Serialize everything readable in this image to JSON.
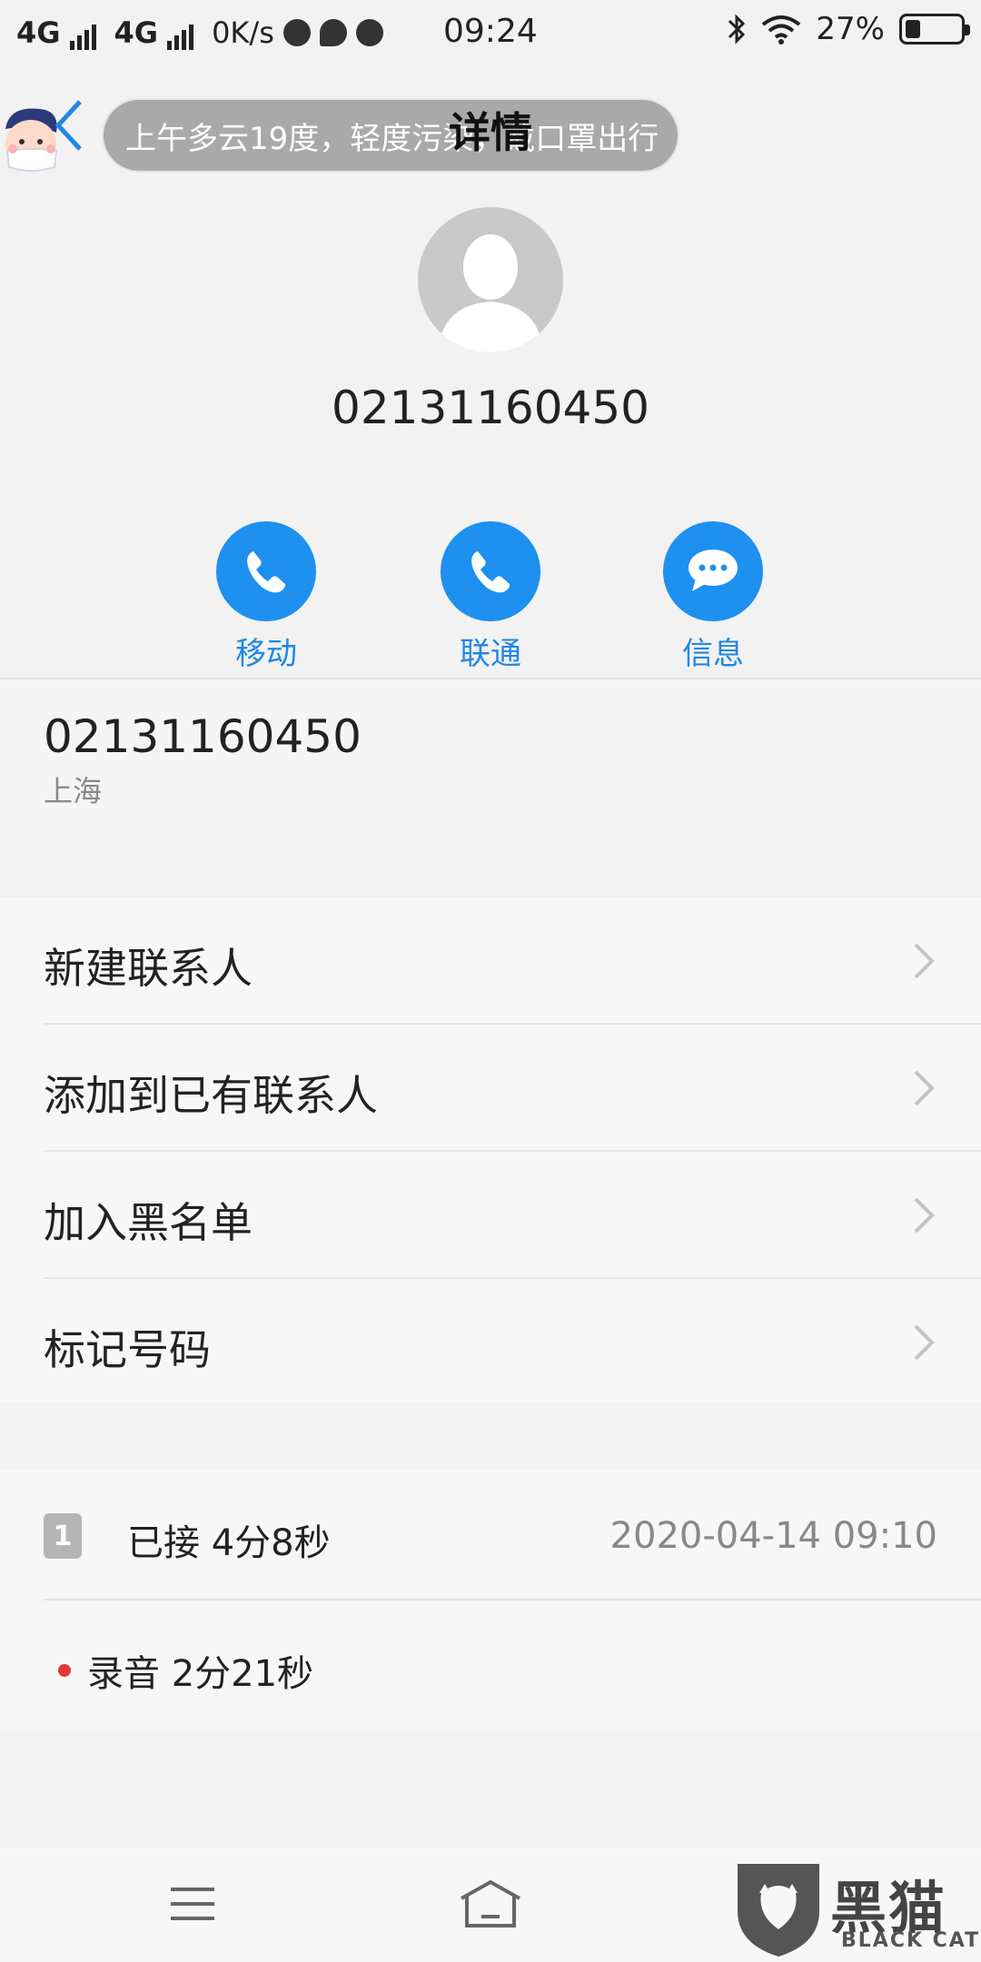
{
  "status_bar": {
    "net1": "4G",
    "net2": "4G",
    "speed": "0K/s",
    "time": "09:24",
    "battery_text": "27%",
    "battery_level": 0.27
  },
  "header": {
    "title": "详情",
    "weather_toast": "上午多云19度，轻度污染，戴口罩出行"
  },
  "contact": {
    "number": "02131160450"
  },
  "actions": [
    {
      "label": "移动",
      "icon": "phone-icon"
    },
    {
      "label": "联通",
      "icon": "phone-icon"
    },
    {
      "label": "信息",
      "icon": "message-icon"
    }
  ],
  "number_info": {
    "number": "02131160450",
    "location": "上海"
  },
  "menu": [
    {
      "label": "新建联系人"
    },
    {
      "label": "添加到已有联系人"
    },
    {
      "label": "加入黑名单"
    },
    {
      "label": "标记号码"
    }
  ],
  "call_log": {
    "sim": "1",
    "status": "已接 4分8秒",
    "datetime": "2020-04-14 09:10",
    "recording": "录音 2分21秒"
  },
  "watermark": {
    "text": "黑猫",
    "sub": "BLACK CAT"
  },
  "colors": {
    "accent": "#1e90f0",
    "record_dot": "#e53935"
  }
}
